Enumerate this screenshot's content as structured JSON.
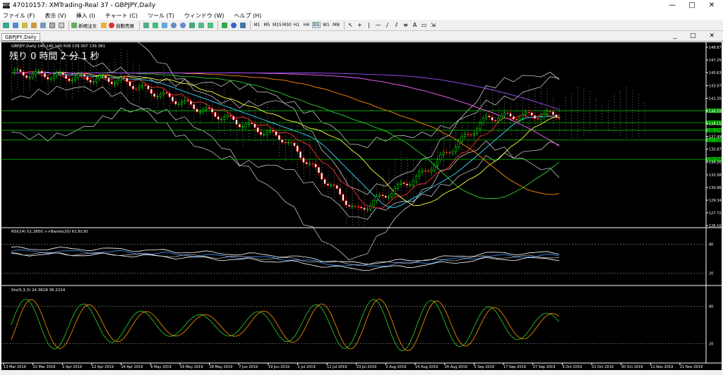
{
  "window": {
    "title": "47010157: XMTrading-Real 37 - GBPJPY,Daily",
    "minimize": "—",
    "maximize": "□",
    "close": "✕"
  },
  "menu": [
    "ファイル (F)",
    "表示 (V)",
    "挿入 (I)",
    "チャート (C)",
    "ツール (T)",
    "ウィンドウ (W)",
    "ヘルプ (H)"
  ],
  "toolbar": {
    "new_order": "新規注文",
    "auto_trade": "自動売買",
    "timeframes": [
      "M1",
      "M5",
      "M15",
      "M30",
      "H1",
      "H4",
      "D1",
      "W1",
      "MN"
    ],
    "selected_timeframe": "D1",
    "text_tool": "A"
  },
  "chart_tab": "GBPJPY,Daily",
  "mdi_controls": "_ □ ✕",
  "main_panel": {
    "header": "GBPJPY,Daily  140.140 140.508 139.307 139.381",
    "countdown": "残り 0 時間 2 分 1 秒",
    "price_labels": [
      "148.875",
      "147.255",
      "145.635",
      "143.970",
      "142.350",
      "140.730",
      "139.110",
      "137.490",
      "135.870",
      "134.205",
      "132.585",
      "130.965",
      "129.345",
      "127.725",
      "126.105"
    ],
    "level_labels": [
      "140.771",
      "139.243",
      "138.274",
      "137.038",
      "134.554"
    ]
  },
  "rsi_panel": {
    "header": "RSI(14) 51.2850   >>Bands(20) 61.8130",
    "levels": [
      "80",
      "20"
    ]
  },
  "stoch_panel": {
    "header": "Sto(5,3,3) 24.3618 36.2224",
    "levels": [
      "80",
      "20"
    ]
  },
  "dates": [
    "13 Mar 2019",
    "22 Mar 2019",
    "2 Apr 2019",
    "12 Apr 2019",
    "24 Apr 2019",
    "6 May 2019",
    "16 May 2019",
    "28 May 2019",
    "7 Jun 2019",
    "19 Jun 2019",
    "1 Jul 2019",
    "11 Jul 2019",
    "23 Jul 2019",
    "2 Aug 2019",
    "14 Aug 2019",
    "26 Aug 2019",
    "5 Sep 2019",
    "17 Sep 2019",
    "27 Sep 2019",
    "9 Oct 2019",
    "21 Oct 2019",
    "30 Oct 2019",
    "11 Nov 2019",
    "21 Nov 2019"
  ],
  "colors": {
    "bg": "#000000",
    "up": "#00ff00",
    "down": "#ff0000",
    "cloud": "#ffffff",
    "level": "#00c000",
    "label_bg": "#00cc00"
  }
}
